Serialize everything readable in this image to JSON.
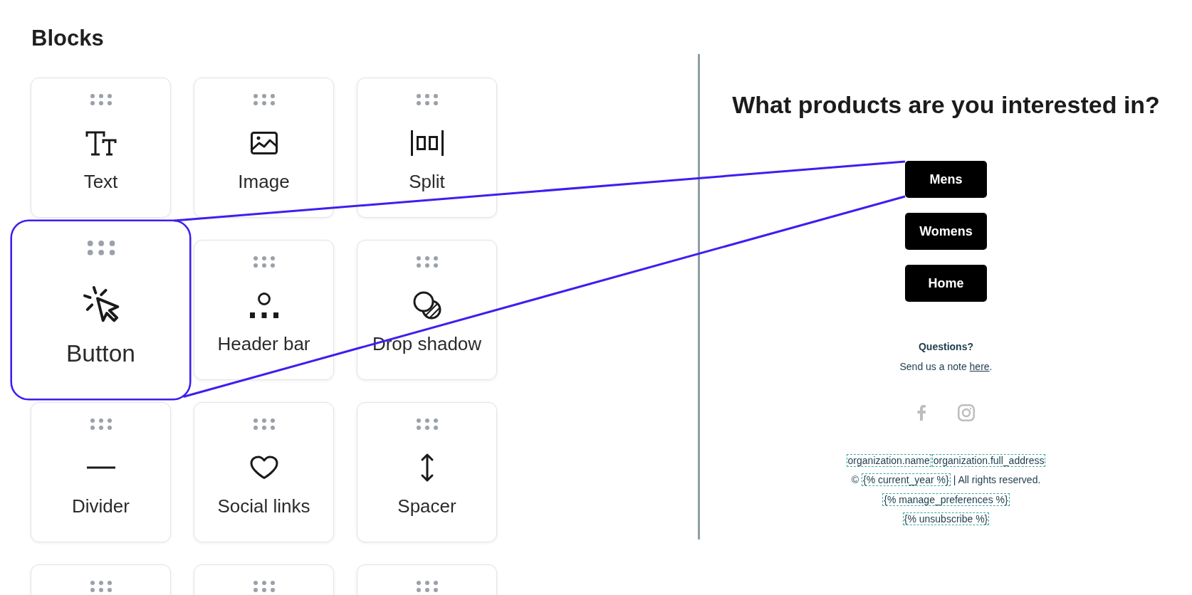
{
  "sidebar": {
    "title": "Blocks",
    "blocks": [
      {
        "kind": "text",
        "label": "Text",
        "highlighted": false
      },
      {
        "kind": "image",
        "label": "Image",
        "highlighted": false
      },
      {
        "kind": "split",
        "label": "Split",
        "highlighted": false
      },
      {
        "kind": "button",
        "label": "Button",
        "highlighted": true
      },
      {
        "kind": "header_bar",
        "label": "Header bar",
        "highlighted": false
      },
      {
        "kind": "drop_shadow",
        "label": "Drop shadow",
        "highlighted": false
      },
      {
        "kind": "divider",
        "label": "Divider",
        "highlighted": false
      },
      {
        "kind": "social_links",
        "label": "Social links",
        "highlighted": false
      },
      {
        "kind": "spacer",
        "label": "Spacer",
        "highlighted": false
      },
      {
        "highlighted": false
      },
      {
        "highlighted": false
      },
      {
        "highlighted": false
      }
    ]
  },
  "preview": {
    "heading": "What products are you interested in?",
    "buttons": [
      {
        "label": "Mens"
      },
      {
        "label": "Womens"
      },
      {
        "label": "Home"
      }
    ],
    "footer": {
      "question": "Questions?",
      "note": {
        "text": "Send us a note",
        "link": "here",
        "end": "."
      },
      "legal_lines": [
        [
          {
            "kind": "tag",
            "text": "organization.name"
          },
          {
            "kind": "tag",
            "text": "organization.full_address"
          }
        ],
        [
          {
            "kind": "text",
            "text": "©"
          },
          {
            "kind": "tag",
            "text": "{% current_year %}"
          },
          {
            "kind": "text",
            "text": "| All rights reserved."
          }
        ],
        [
          {
            "kind": "tag",
            "text": "{% manage_preferences %}"
          }
        ],
        [
          {
            "kind": "tag",
            "text": "{% unsubscribe %}"
          }
        ]
      ]
    }
  }
}
